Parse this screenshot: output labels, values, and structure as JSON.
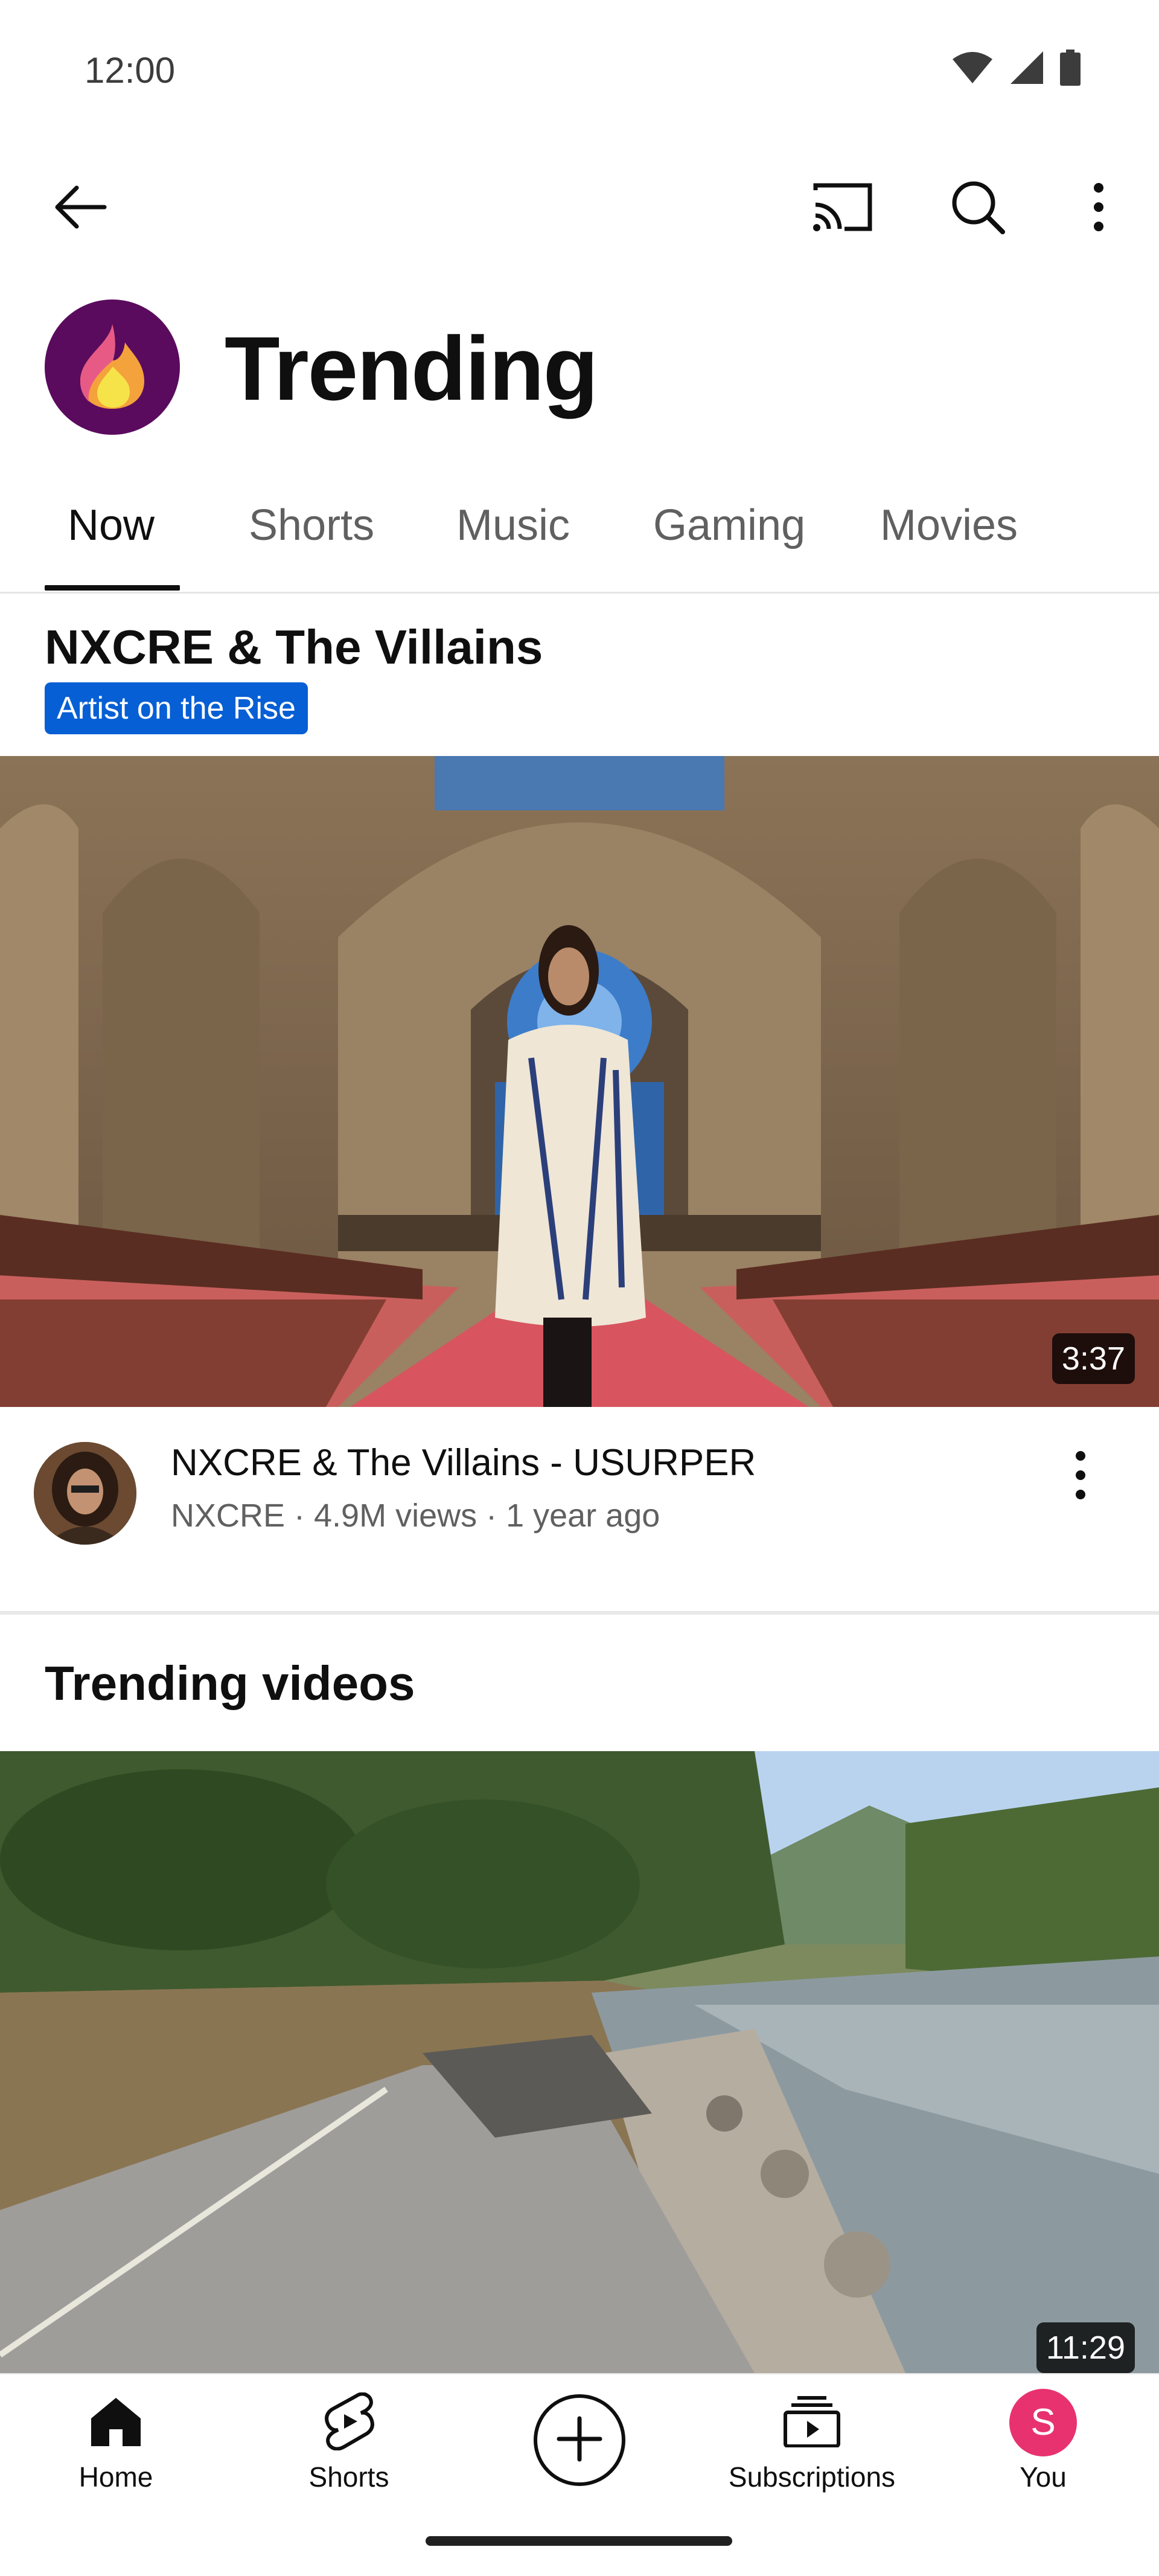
{
  "status_bar": {
    "time": "12:00",
    "icons": [
      "wifi-icon",
      "signal-icon",
      "battery-icon"
    ]
  },
  "app_bar": {
    "icons": [
      "back-arrow-icon",
      "cast-icon",
      "search-icon",
      "more-vertical-icon"
    ]
  },
  "header": {
    "title": "Trending",
    "logo_icon": "trending-flame-icon"
  },
  "tabs": [
    {
      "label": "Now",
      "active": true
    },
    {
      "label": "Shorts",
      "active": false
    },
    {
      "label": "Music",
      "active": false
    },
    {
      "label": "Gaming",
      "active": false
    },
    {
      "label": "Movies",
      "active": false
    }
  ],
  "featured": {
    "artist": "NXCRE & The Villains",
    "badge": "Artist on the Rise",
    "video": {
      "duration": "3:37",
      "title": "NXCRE & The Villains - USURPER",
      "meta": "NXCRE · 4.9M views · 1 year ago"
    }
  },
  "trending_section": {
    "title": "Trending videos",
    "first_video": {
      "duration": "11:29"
    }
  },
  "bottom_nav": {
    "items": [
      {
        "label": "Home",
        "icon": "home-icon"
      },
      {
        "label": "Shorts",
        "icon": "shorts-icon"
      },
      {
        "label": "",
        "icon": "create-plus-icon"
      },
      {
        "label": "Subscriptions",
        "icon": "subscriptions-icon"
      },
      {
        "label": "You",
        "icon": "avatar"
      }
    ],
    "you_initial": "S"
  },
  "colors": {
    "badge_blue": "#065fd4",
    "logo_purple": "#5a0b5e",
    "you_avatar": "#e8326f"
  }
}
